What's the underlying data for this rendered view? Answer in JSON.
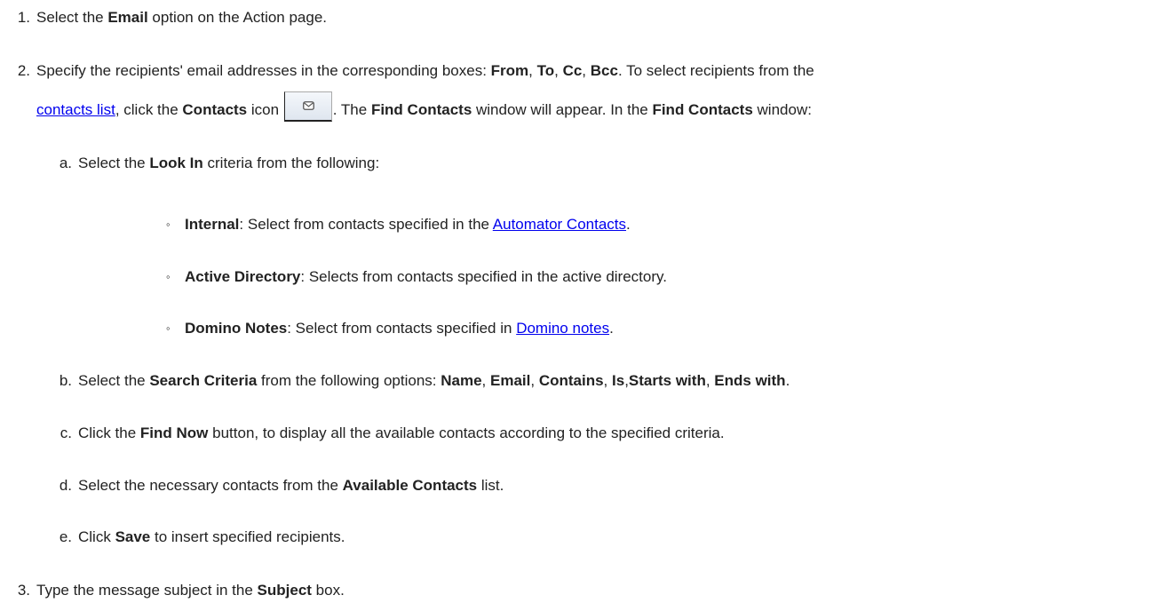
{
  "step1": {
    "num": "1.",
    "t1": "Select the ",
    "b1": "Email",
    "t2": " option on the Action page."
  },
  "step2": {
    "num": "2.",
    "t1": "Specify the recipients' email addresses in the corresponding boxes: ",
    "b_from": "From",
    "c1": ", ",
    "b_to": "To",
    "c2": ", ",
    "b_cc": "Cc",
    "c3": ", ",
    "b_bcc": "Bcc",
    "t2": ". To select recipients from the",
    "link_contacts": "contacts list",
    "t3": ", click the ",
    "b_contacts": "Contacts",
    "t4": " icon ",
    "t5": ". The ",
    "b_find": "Find Contacts",
    "t6": " window will appear. In the ",
    "b_find2": "Find Contacts",
    "t7": " window:",
    "sub_a": {
      "num": "a.",
      "t1": "Select the ",
      "b1": "Look In",
      "t2": " criteria from the following:",
      "bullets": [
        {
          "mark": "◦",
          "b": "Internal",
          "t": ":  Select from contacts specified in the ",
          "link": "Automator Contacts",
          "end": "."
        },
        {
          "mark": "◦",
          "b": "Active Directory",
          "t": ": Selects from contacts specified in the active directory."
        },
        {
          "mark": "◦",
          "b": "Domino Notes",
          "t": ": Select from contacts specified in ",
          "link": "Domino notes",
          "end": "."
        }
      ]
    },
    "sub_b": {
      "num": "b.",
      "t1": "Select the ",
      "b1": "Search Criteria",
      "t2": " from the following options: ",
      "o1": "Name",
      "s1": ", ",
      "o2": "Email",
      "s2": ", ",
      "o3": "Contains",
      "s3": ", ",
      "o4": "Is",
      "s4": ",",
      "o5": "Starts with",
      "s5": ", ",
      "o6": "Ends with",
      "end": "."
    },
    "sub_c": {
      "num": "c.",
      "t1": "Click the ",
      "b1": "Find Now",
      "t2": " button, to display all the available contacts according to the specified criteria."
    },
    "sub_d": {
      "num": "d.",
      "t1": "Select the necessary contacts from the ",
      "b1": "Available Contacts",
      "t2": " list."
    },
    "sub_e": {
      "num": "e.",
      "t1": "Click ",
      "b1": "Save",
      "t2": " to insert specified recipients."
    }
  },
  "step3": {
    "num": "3.",
    "t1": "Type the message subject in the ",
    "b1": "Subject",
    "t2": " box."
  },
  "icons": {
    "contacts_button": "envelope-icon"
  }
}
